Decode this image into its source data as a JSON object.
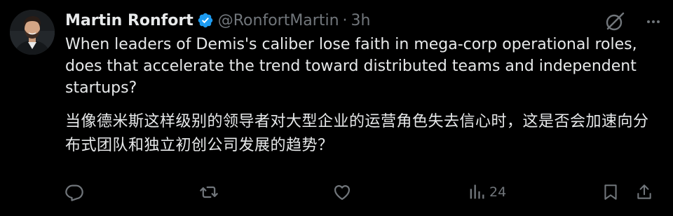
{
  "tweet": {
    "author": {
      "display_name": "Martin Ronfort",
      "verified": true,
      "handle": "@RonfortMartin",
      "separator": "·",
      "time": "3h"
    },
    "text_en": "When leaders of Demis's caliber lose faith in mega-corp operational roles, does that accelerate the trend toward distributed teams and independent startups?",
    "text_zh": "当像德米斯这样级别的领导者对大型企业的运营角色失去信心时，这是否会加速向分布式团队和独立初创公司发展的趋势？",
    "actions": {
      "reply": {
        "icon": "reply-icon",
        "count": ""
      },
      "repost": {
        "icon": "repost-icon",
        "count": ""
      },
      "like": {
        "icon": "like-icon",
        "count": ""
      },
      "views": {
        "icon": "views-icon",
        "count": "24"
      },
      "bookmark": {
        "icon": "bookmark-icon",
        "count": ""
      },
      "share": {
        "icon": "share-icon",
        "count": ""
      }
    },
    "top_icons": {
      "grok": "grok-icon",
      "more": "more-icon"
    }
  },
  "colors": {
    "background": "#000000",
    "text_primary": "#e7e9ea",
    "text_secondary": "#71767b",
    "verified_blue": "#1d9bf0"
  }
}
